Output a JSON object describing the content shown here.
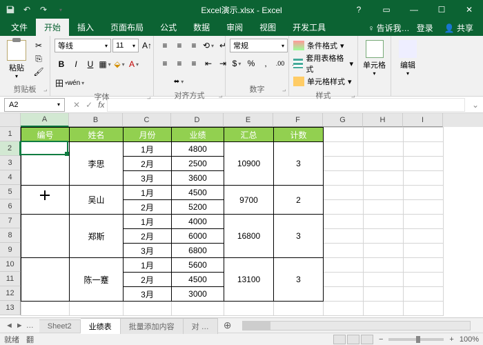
{
  "title": "Excel演示.xlsx - Excel",
  "tabs": {
    "file": "文件",
    "home": "开始",
    "insert": "插入",
    "layout": "页面布局",
    "formulas": "公式",
    "data": "数据",
    "review": "审阅",
    "view": "视图",
    "dev": "开发工具",
    "tellme": "告诉我…",
    "signin": "登录",
    "share": "共享"
  },
  "ribbon": {
    "clipboard": {
      "paste": "粘贴",
      "label": "剪贴板"
    },
    "font": {
      "name": "等线",
      "size": "11",
      "label": "字体"
    },
    "align": {
      "label": "对齐方式"
    },
    "number": {
      "format": "常规",
      "label": "数字"
    },
    "styles": {
      "cond": "条件格式",
      "table": "套用表格格式",
      "cell": "单元格样式",
      "label": "样式"
    },
    "cells": {
      "btn": "单元格"
    },
    "edit": {
      "btn": "编辑"
    }
  },
  "namebox": "A2",
  "headers": {
    "A": "编号",
    "B": "姓名",
    "C": "月份",
    "D": "业绩",
    "E": "汇总",
    "F": "计数"
  },
  "data_rows": [
    {
      "name": "李思",
      "months": [
        "1月",
        "2月",
        "3月"
      ],
      "perf": [
        "4800",
        "2500",
        "3600"
      ],
      "sum": "10900",
      "count": "3"
    },
    {
      "name": "吴山",
      "months": [
        "1月",
        "2月"
      ],
      "perf": [
        "4500",
        "5200"
      ],
      "sum": "9700",
      "count": "2"
    },
    {
      "name": "郑斯",
      "months": [
        "1月",
        "2月",
        "3月"
      ],
      "perf": [
        "4000",
        "6000",
        "6800"
      ],
      "sum": "16800",
      "count": "3"
    },
    {
      "name": "陈一蹇",
      "months": [
        "1月",
        "2月",
        "3月"
      ],
      "perf": [
        "5600",
        "4500",
        "3000"
      ],
      "sum": "13100",
      "count": "3"
    }
  ],
  "sheets": {
    "s1": "Sheet2",
    "s2": "业绩表",
    "s3": "批量添加内容",
    "s4": "对 …"
  },
  "status": {
    "ready": "就绪",
    "macro": "翻",
    "zoom": "100%"
  },
  "colwidths": {
    "A": 70,
    "B": 78,
    "C": 70,
    "D": 76,
    "E": 72,
    "F": 72,
    "G": 58,
    "H": 58,
    "I": 58
  }
}
